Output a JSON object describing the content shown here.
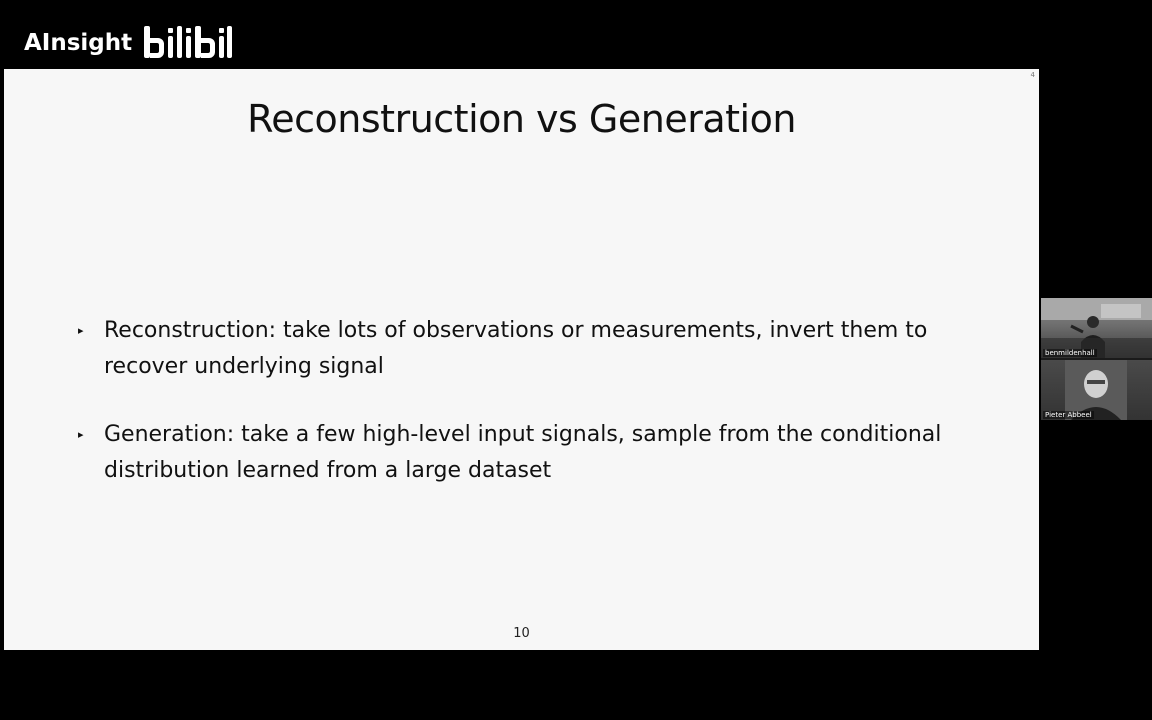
{
  "watermark": {
    "text": "AInsight",
    "logo": "bilibili"
  },
  "slide": {
    "title": "Reconstruction vs Generation",
    "corner_mark": "4",
    "bullets": [
      {
        "marker": "▸",
        "text": "Reconstruction: take lots of observations or measurements, invert them to recover underlying signal"
      },
      {
        "marker": "▸",
        "text": "Generation: take a few high-level input signals, sample from the conditional distribution learned from a large dataset"
      }
    ],
    "page_number": "10"
  },
  "participants": [
    {
      "name": "benmildenhall",
      "icon": "person-video-icon"
    },
    {
      "name": "Pieter Abbeel",
      "icon": "person-video-icon"
    }
  ],
  "colors": {
    "background": "#000000",
    "slide_background": "#f7f7f7",
    "text": "#111111"
  }
}
